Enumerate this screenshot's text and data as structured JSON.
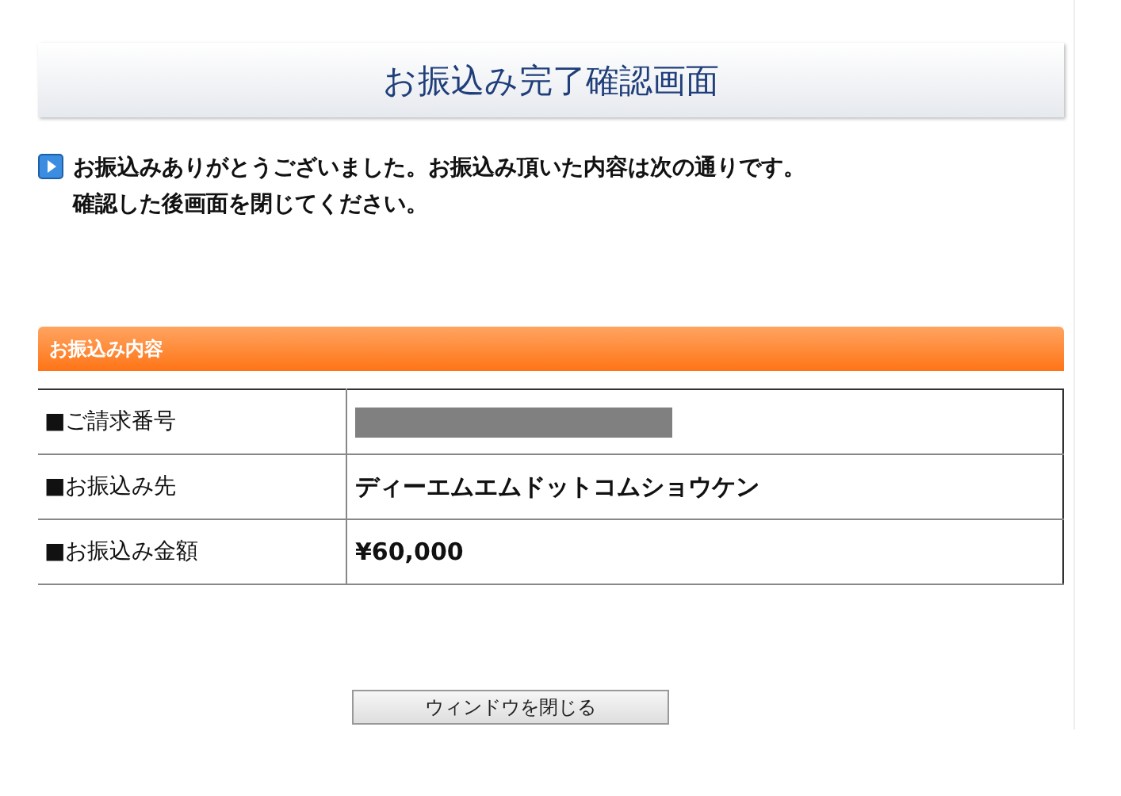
{
  "title": "お振込み完了確認画面",
  "message": [
    "お振込みありがとうございました。お振込み頂いた内容は次の通りです。",
    "確認した後画面を閉じてください。"
  ],
  "section": {
    "heading": "お振込み内容",
    "rows": [
      {
        "label": "■ご請求番号",
        "kind": "redacted"
      },
      {
        "label": "■お振込み先",
        "kind": "text",
        "value": "ディーエムエムドットコムショウケン"
      },
      {
        "label": "■お振込み金額",
        "kind": "text",
        "value": "¥60,000"
      }
    ]
  },
  "buttons": [
    "ウィンドウを閉じる"
  ]
}
